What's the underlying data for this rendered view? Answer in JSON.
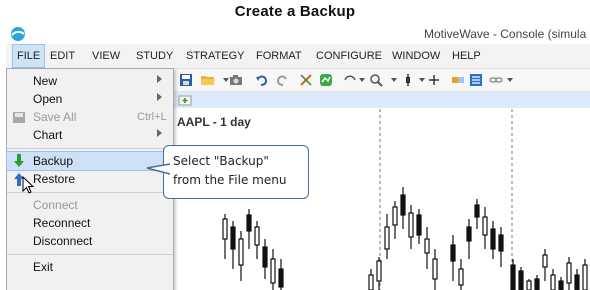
{
  "heading": "Create a Backup",
  "window": {
    "title": "MotiveWave - Console (simula"
  },
  "menubar": [
    "FILE",
    "EDIT",
    "VIEW",
    "STUDY",
    "STRATEGY",
    "FORMAT",
    "CONFIGURE",
    "WINDOW",
    "HELP"
  ],
  "file_menu": {
    "items": [
      {
        "label": "New",
        "submenu": true,
        "enabled": true
      },
      {
        "label": "Open",
        "submenu": true,
        "enabled": true
      },
      {
        "label": "Save All",
        "shortcut": "Ctrl+L",
        "enabled": false,
        "icon": "save-icon"
      },
      {
        "label": "Chart",
        "submenu": true,
        "enabled": true
      },
      {
        "label": "Backup",
        "enabled": true,
        "icon": "backup-arrow-icon",
        "highlighted": true
      },
      {
        "label": "Restore",
        "enabled": true,
        "icon": "restore-arrow-icon"
      },
      {
        "label": "Connect",
        "enabled": false
      },
      {
        "label": "Reconnect",
        "enabled": true
      },
      {
        "label": "Disconnect",
        "enabled": true
      },
      {
        "label": "Exit",
        "enabled": true
      }
    ]
  },
  "chart": {
    "title": "AAPL - 1 day"
  },
  "callout": {
    "line1": "Select \"Backup\"",
    "line2": "from the File menu"
  },
  "colors": {
    "accent": "#4b6c9c",
    "highlight": "#cde0f5",
    "tabstrip": "#dcebfb",
    "backup_arrow": "#2e9d2e",
    "restore_arrow": "#2f6fc4"
  }
}
